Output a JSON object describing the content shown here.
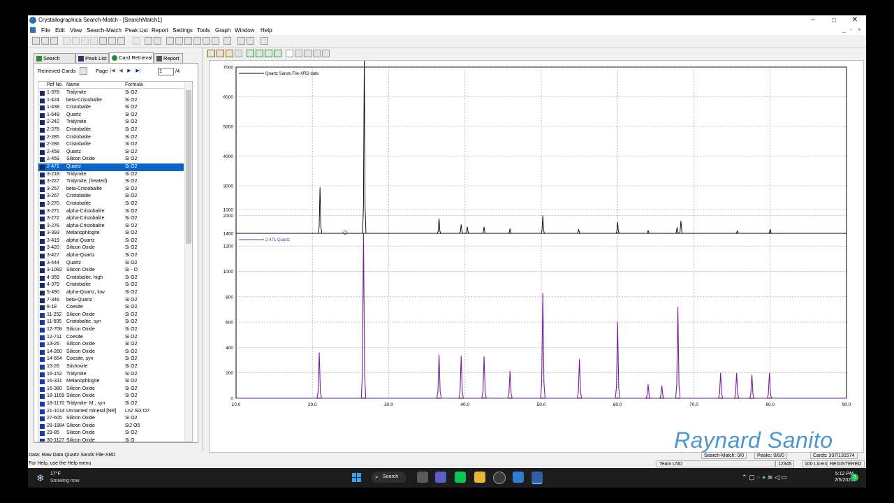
{
  "window": {
    "title": "Crystallographica Search-Match - [SearchMatch1]",
    "minimize": "–",
    "maximize": "□",
    "close": "✕",
    "mdi_min": "_",
    "mdi_restore": "▫",
    "mdi_close": "×"
  },
  "menu": [
    "File",
    "Edit",
    "View",
    "Search-Match",
    "Peak List",
    "Report",
    "Settings",
    "Tools",
    "Graph",
    "Window",
    "Help"
  ],
  "tabs": [
    {
      "label": "Search Match",
      "active": false
    },
    {
      "label": "Peak List",
      "active": false
    },
    {
      "label": "Card Retrieval",
      "active": true
    },
    {
      "label": "Report",
      "active": false
    }
  ],
  "pager": {
    "retrieved_label": "Retrieved Cards",
    "page_label": "Page",
    "page_value": "1",
    "page_total": "/4"
  },
  "card_columns": [
    "Pdf No.",
    "Name",
    "Formula"
  ],
  "cards": [
    {
      "no": "1-378",
      "name": "Tridymite",
      "formula": "Si O2",
      "type": "x"
    },
    {
      "no": "1-424",
      "name": "beta-Cristobalite",
      "formula": "Si O2",
      "type": "x"
    },
    {
      "no": "1-438",
      "name": "Cristobalite",
      "formula": "Si O2",
      "type": "x"
    },
    {
      "no": "1-649",
      "name": "Quartz",
      "formula": "Si O2",
      "type": "x"
    },
    {
      "no": "2-242",
      "name": "Tridymite",
      "formula": "Si O2",
      "type": "x"
    },
    {
      "no": "2-278",
      "name": "Cristobalite",
      "formula": "Si O2",
      "type": "x"
    },
    {
      "no": "2-285",
      "name": "Cristobalite",
      "formula": "Si O2",
      "type": "x"
    },
    {
      "no": "2-286",
      "name": "Cristobalite",
      "formula": "Si O2",
      "type": "x"
    },
    {
      "no": "2-458",
      "name": "Quartz",
      "formula": "Si O2",
      "type": "x"
    },
    {
      "no": "2-459",
      "name": "Silicon Oxide",
      "formula": "Si O2",
      "type": "x"
    },
    {
      "no": "2-471",
      "name": "Quartz",
      "formula": "Si O2",
      "type": "x",
      "selected": true
    },
    {
      "no": "3-218",
      "name": "Tridymite",
      "formula": "Si O2",
      "type": "x"
    },
    {
      "no": "3-227",
      "name": "Tridymite, (heated)",
      "formula": "Si O2",
      "type": "x"
    },
    {
      "no": "3-257",
      "name": "beta-Cristobalite",
      "formula": "Si O2",
      "type": "x"
    },
    {
      "no": "3-267",
      "name": "Cristobalite",
      "formula": "Si O2",
      "type": "x"
    },
    {
      "no": "3-270",
      "name": "Cristobalite",
      "formula": "Si O2",
      "type": "x"
    },
    {
      "no": "3-271",
      "name": "alpha-Cristobalite",
      "formula": "Si O2",
      "type": "x"
    },
    {
      "no": "3-272",
      "name": "alpha-Cristobalite",
      "formula": "Si O2",
      "type": "x"
    },
    {
      "no": "3-276",
      "name": "alpha-Cristobalite",
      "formula": "Si O2",
      "type": "x"
    },
    {
      "no": "3-393",
      "name": "Melanophlogite",
      "formula": "Si O2",
      "type": "x"
    },
    {
      "no": "3-419",
      "name": "alpha-Quartz",
      "formula": "Si O2",
      "type": "x"
    },
    {
      "no": "3-420",
      "name": "Silicon Oxide",
      "formula": "Si O2",
      "type": "x"
    },
    {
      "no": "3-427",
      "name": "alpha-Quartz",
      "formula": "Si O2",
      "type": "x"
    },
    {
      "no": "3-444",
      "name": "Quartz",
      "formula": "Si O2",
      "type": "x"
    },
    {
      "no": "3-1092",
      "name": "Silicon Oxide",
      "formula": "Si - O",
      "type": "x"
    },
    {
      "no": "4-359",
      "name": "Cristobalite, high",
      "formula": "Si O2",
      "type": "x"
    },
    {
      "no": "4-379",
      "name": "Cristobalite",
      "formula": "Si O2",
      "type": "x"
    },
    {
      "no": "5-490",
      "name": "alpha-Quartz, low",
      "formula": "Si O2",
      "type": "x"
    },
    {
      "no": "7-346",
      "name": "beta-Quartz",
      "formula": "Si O2",
      "type": "x"
    },
    {
      "no": "8-18",
      "name": "Coesite",
      "formula": "Si O2",
      "type": "x"
    },
    {
      "no": "11-252",
      "name": "Silicon Oxide",
      "formula": "Si O2",
      "type": "b"
    },
    {
      "no": "11-695",
      "name": "Cristobalite, syn",
      "formula": "Si O2",
      "type": "b"
    },
    {
      "no": "12-708",
      "name": "Silicon Oxide",
      "formula": "Si O2",
      "type": "b"
    },
    {
      "no": "12-711",
      "name": "Coesite",
      "formula": "Si O2",
      "type": "b"
    },
    {
      "no": "13-26",
      "name": "Silicon Oxide",
      "formula": "Si O2",
      "type": "b"
    },
    {
      "no": "14-260",
      "name": "Silicon Oxide",
      "formula": "Si O2",
      "type": "b"
    },
    {
      "no": "14-654",
      "name": "Coesite, syn",
      "formula": "Si O2",
      "type": "b"
    },
    {
      "no": "15-26",
      "name": "Stishovite",
      "formula": "Si O2",
      "type": "b"
    },
    {
      "no": "16-152",
      "name": "Tridymite",
      "formula": "Si O2",
      "type": "b"
    },
    {
      "no": "16-331",
      "name": "Melanophlogite",
      "formula": "Si O2",
      "type": "b"
    },
    {
      "no": "16-380",
      "name": "Silicon Oxide",
      "formula": "Si O2",
      "type": "b"
    },
    {
      "no": "18-1169",
      "name": "Silicon Oxide",
      "formula": "Si O2",
      "type": "b"
    },
    {
      "no": "18-1170",
      "name": "Tridymite- M , syn",
      "formula": "Si O2",
      "type": "b"
    },
    {
      "no": "21-1014",
      "name": "Unnamed mineral [NR]",
      "formula": "Ln2 Si2 O7",
      "type": "b"
    },
    {
      "no": "27-605",
      "name": "Silicon Oxide",
      "formula": "Si O2",
      "type": "b"
    },
    {
      "no": "28-1884",
      "name": "Silicon Oxide",
      "formula": "Si2 O5",
      "type": "b"
    },
    {
      "no": "29-85",
      "name": "Silicon Oxide",
      "formula": "Si O2",
      "type": "b"
    },
    {
      "no": "30-1127",
      "name": "Silicon Oxide",
      "formula": "Si O",
      "type": "b"
    }
  ],
  "chart_data": [
    {
      "type": "line",
      "series": [
        {
          "name": "Quartz Sands File-XRD data",
          "color": "#000000"
        }
      ],
      "xlim": [
        10,
        90
      ],
      "ylim": [
        1400,
        7000
      ],
      "yticks": [
        1400,
        1000,
        2000,
        3000,
        4000,
        5000,
        6000,
        7000
      ],
      "baseline": 1400,
      "peaks": [
        [
          21.0,
          2950
        ],
        [
          26.8,
          7400
        ],
        [
          36.6,
          1900
        ],
        [
          39.5,
          1700
        ],
        [
          40.3,
          1620
        ],
        [
          42.5,
          1620
        ],
        [
          45.9,
          1560
        ],
        [
          50.2,
          2000
        ],
        [
          54.9,
          1520
        ],
        [
          60.0,
          1780
        ],
        [
          64.0,
          1490
        ],
        [
          67.8,
          1600
        ],
        [
          68.3,
          1820
        ],
        [
          75.7,
          1480
        ],
        [
          80.0,
          1540
        ]
      ],
      "grid": true
    },
    {
      "type": "line",
      "series": [
        {
          "name": "2-471 Quartz",
          "color": "#7a1fa2"
        }
      ],
      "xlim": [
        10,
        90
      ],
      "ylim": [
        0,
        1300
      ],
      "yticks": [
        0,
        200,
        400,
        600,
        800,
        1000,
        1200
      ],
      "peaks": [
        [
          20.9,
          360
        ],
        [
          26.7,
          1300
        ],
        [
          36.6,
          345
        ],
        [
          39.5,
          335
        ],
        [
          42.5,
          330
        ],
        [
          45.9,
          215
        ],
        [
          50.2,
          830
        ],
        [
          55.0,
          310
        ],
        [
          60.0,
          600
        ],
        [
          64.0,
          110
        ],
        [
          65.8,
          100
        ],
        [
          67.9,
          720
        ],
        [
          73.5,
          200
        ],
        [
          75.6,
          200
        ],
        [
          77.6,
          185
        ],
        [
          79.9,
          200
        ]
      ],
      "grid": true
    }
  ],
  "xticks": [
    "10.0",
    "20.0",
    "30.0",
    "40.0",
    "50.0",
    "60.0",
    "70.0",
    "80.0",
    "90.0"
  ],
  "status": {
    "data": "Data: Raw Data Quartz Sands File-XRD",
    "help": "For Help, use the Help menu",
    "search_match": "Search-Match: 0/0",
    "peaks": "Peaks: 0/0/0",
    "cards": "Cards: 337/131574",
    "team": "Team LND",
    "serial": "12345",
    "licences": "100 Licences",
    "registered": "REGISTERED"
  },
  "watermark": "Raynard Sanito",
  "taskbar": {
    "temp": "17°F",
    "weather": "Snowing now",
    "search": "Search",
    "time": "5:12 PM",
    "date": "2/5/2023",
    "notif": "3"
  },
  "colors": {
    "accent": "#0a64c8",
    "purple": "#7a1fa2",
    "watermark": "#4a97d4"
  }
}
